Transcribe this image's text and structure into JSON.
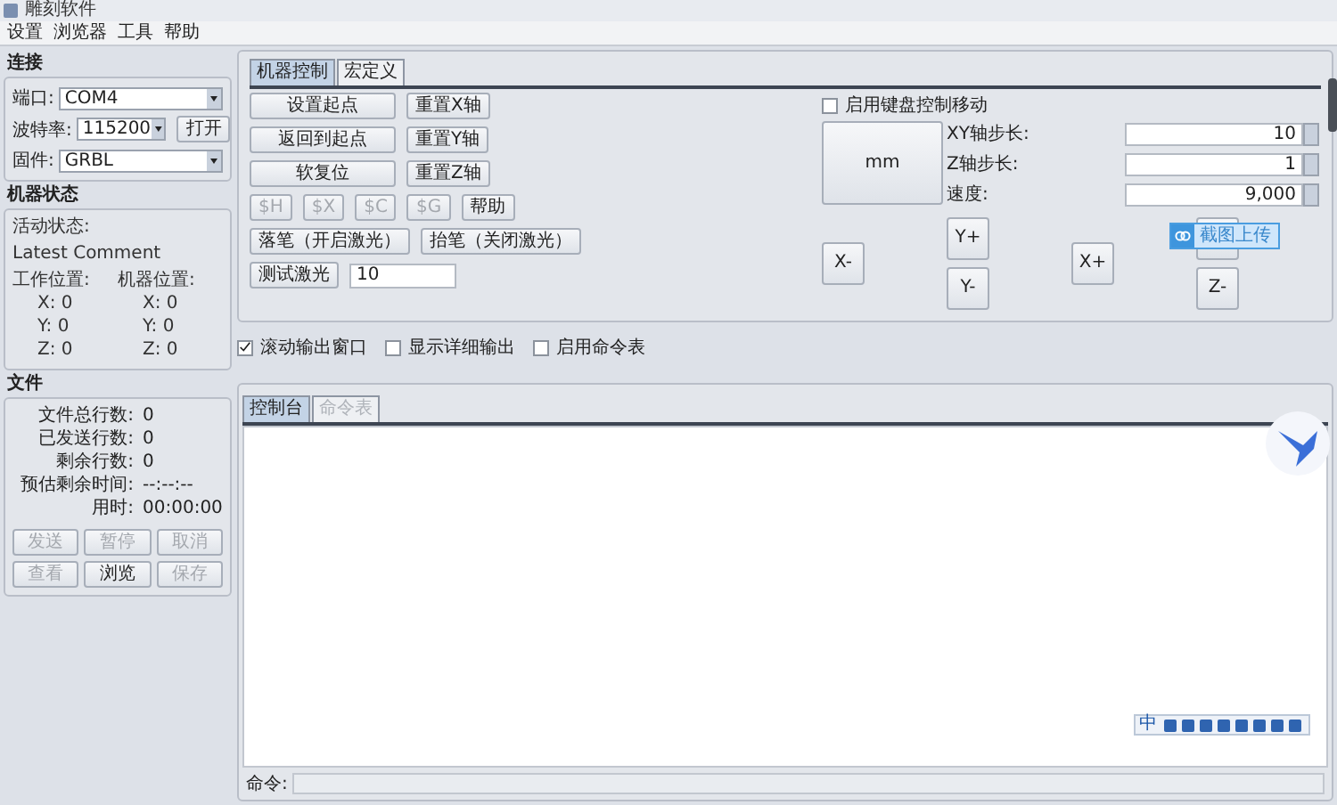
{
  "window": {
    "title": "雕刻软件"
  },
  "menu": [
    "设置",
    "浏览器",
    "工具",
    "帮助"
  ],
  "connection": {
    "heading": "连接",
    "port": {
      "label": "端口:",
      "value": "COM4"
    },
    "baud": {
      "label": "波特率:",
      "value": "115200"
    },
    "open_button": "打开",
    "firmware": {
      "label": "固件:",
      "value": "GRBL"
    }
  },
  "machine_status": {
    "heading": "机器状态",
    "state_label": "活动状态:",
    "comment": "Latest Comment",
    "work_label": "工作位置:",
    "machine_label": "机器位置:",
    "work": [
      {
        "axis": "X:",
        "value": "0"
      },
      {
        "axis": "Y:",
        "value": "0"
      },
      {
        "axis": "Z:",
        "value": "0"
      }
    ],
    "machine": [
      {
        "axis": "X:",
        "value": "0"
      },
      {
        "axis": "Y:",
        "value": "0"
      },
      {
        "axis": "Z:",
        "value": "0"
      }
    ]
  },
  "file": {
    "heading": "文件",
    "stats": [
      {
        "label": "文件总行数:",
        "value": "0"
      },
      {
        "label": "已发送行数:",
        "value": "0"
      },
      {
        "label": "剩余行数:",
        "value": "0"
      },
      {
        "label": "预估剩余时间:",
        "value": "--:--:--"
      },
      {
        "label": "用时:",
        "value": "00:00:00"
      }
    ],
    "buttons": [
      {
        "label": "发送",
        "disabled": true
      },
      {
        "label": "暂停",
        "disabled": true
      },
      {
        "label": "取消",
        "disabled": true
      },
      {
        "label": "查看",
        "disabled": true
      },
      {
        "label": "浏览",
        "disabled": false
      },
      {
        "label": "保存",
        "disabled": true
      }
    ]
  },
  "control_tabs": [
    {
      "label": "机器控制",
      "selected": true
    },
    {
      "label": "宏定义",
      "selected": false
    }
  ],
  "axis_rows": [
    {
      "main": "设置起点",
      "reset": "重置X轴"
    },
    {
      "main": "返回到起点",
      "reset": "重置Y轴"
    },
    {
      "main": "软复位",
      "reset": "重置Z轴"
    }
  ],
  "command_buttons": [
    {
      "label": "$H",
      "disabled": true
    },
    {
      "label": "$X",
      "disabled": true
    },
    {
      "label": "$C",
      "disabled": true
    },
    {
      "label": "$G",
      "disabled": true
    },
    {
      "label": "帮助",
      "disabled": false
    }
  ],
  "pen_buttons": [
    "落笔（开启激光）",
    "抬笔（关闭激光）"
  ],
  "test_laser": {
    "button": "测试激光",
    "value": "10"
  },
  "keyboard_jog": {
    "label": "启用键盘控制移动",
    "checked": false
  },
  "unit_button": "mm",
  "steps": [
    {
      "label": "XY轴步长:",
      "value": "10"
    },
    {
      "label": "Z轴步长:",
      "value": "1"
    },
    {
      "label": "速度:",
      "value": "9,000"
    }
  ],
  "jog_buttons": [
    {
      "label": "X-"
    },
    {
      "label": "Y+"
    },
    {
      "label": "Y-"
    },
    {
      "label": "X+"
    },
    {
      "label": "Z-"
    }
  ],
  "screenshot_upload": "截图上传",
  "options": [
    {
      "label": "滚动输出窗口",
      "checked": true
    },
    {
      "label": "显示详细输出",
      "checked": false
    },
    {
      "label": "启用命令表",
      "checked": false
    }
  ],
  "console_tabs": [
    {
      "label": "控制台",
      "selected": true,
      "disabled": false
    },
    {
      "label": "命令表",
      "selected": false,
      "disabled": true
    }
  ],
  "ime": {
    "label": "中"
  },
  "command": {
    "label": "命令:"
  }
}
